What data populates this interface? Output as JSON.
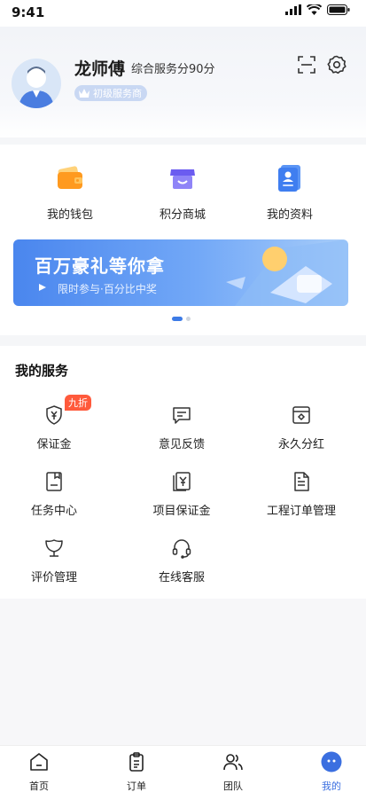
{
  "status_bar": {
    "time": "9:41"
  },
  "profile": {
    "name": "龙师傅",
    "score_text": "综合服务分90分",
    "level": "初级服务商"
  },
  "quick_entries": [
    {
      "label": "我的钱包",
      "icon": "wallet-icon"
    },
    {
      "label": "积分商城",
      "icon": "shop-icon"
    },
    {
      "label": "我的资料",
      "icon": "profile-card-icon"
    }
  ],
  "banner": {
    "title": "百万豪礼等你拿",
    "subtitle": "限时参与·百分比中奖"
  },
  "services": {
    "title": "我的服务",
    "items": [
      {
        "label": "保证金",
        "icon": "shield-yen-icon",
        "badge": "九折"
      },
      {
        "label": "意见反馈",
        "icon": "feedback-icon"
      },
      {
        "label": "永久分红",
        "icon": "dividend-icon"
      },
      {
        "label": "任务中心",
        "icon": "task-icon"
      },
      {
        "label": "项目保证金",
        "icon": "project-deposit-icon"
      },
      {
        "label": "工程订单管理",
        "icon": "order-doc-icon"
      },
      {
        "label": "评价管理",
        "icon": "review-icon"
      },
      {
        "label": "在线客服",
        "icon": "headset-icon"
      }
    ]
  },
  "tabbar": {
    "items": [
      {
        "label": "首页",
        "icon": "home-icon"
      },
      {
        "label": "订单",
        "icon": "clipboard-icon"
      },
      {
        "label": "团队",
        "icon": "team-icon"
      },
      {
        "label": "我的",
        "icon": "me-icon"
      }
    ],
    "active_color": "#3b6fe0"
  }
}
